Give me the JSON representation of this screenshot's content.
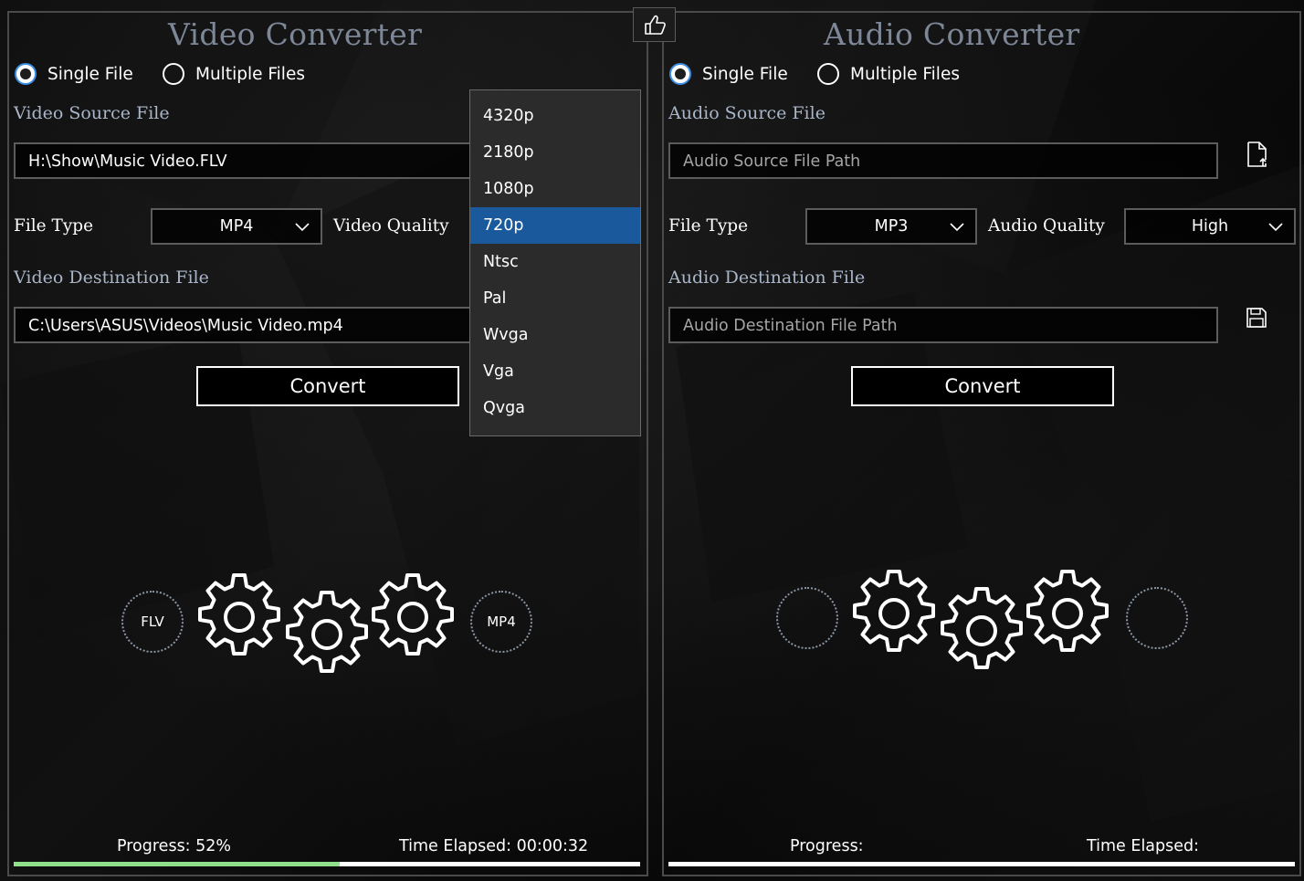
{
  "video": {
    "title": "Video Converter",
    "mode_single": "Single File",
    "mode_multiple": "Multiple Files",
    "source_label": "Video Source File",
    "source_value": "H:\\Show\\Music Video.FLV",
    "file_type_label": "File Type",
    "file_type_value": "MP4",
    "quality_label": "Video Quality",
    "quality_options": [
      "4320p",
      "2180p",
      "1080p",
      "720p",
      "Ntsc",
      "Pal",
      "Wvga",
      "Vga",
      "Qvga"
    ],
    "quality_selected": "720p",
    "destination_label": "Video Destination File",
    "destination_value": "C:\\Users\\ASUS\\Videos\\Music Video.mp4",
    "convert_label": "Convert",
    "from_format": "FLV",
    "to_format": "MP4",
    "progress_text": "Progress: 52%",
    "progress_fraction": 0.52,
    "elapsed_text": "Time Elapsed: 00:00:32"
  },
  "audio": {
    "title": "Audio Converter",
    "mode_single": "Single File",
    "mode_multiple": "Multiple Files",
    "source_label": "Audio Source File",
    "source_placeholder": "Audio Source File Path",
    "file_type_label": "File Type",
    "file_type_value": "MP3",
    "quality_label": "Audio Quality",
    "quality_value": "High",
    "destination_label": "Audio Destination File",
    "destination_placeholder": "Audio Destination File Path",
    "convert_label": "Convert",
    "progress_text": "Progress:",
    "progress_fraction": 0,
    "elapsed_text": "Time Elapsed:"
  },
  "colors": {
    "accent": "#1a5a9c",
    "progress_fill": "#8fe08a",
    "title": "#7d8797",
    "label": "#a9b6c8"
  },
  "icons": {
    "top_button": "thumbs-up-icon",
    "open_file": "open-file-icon",
    "save_file": "save-icon",
    "gear": "gear-icon"
  }
}
